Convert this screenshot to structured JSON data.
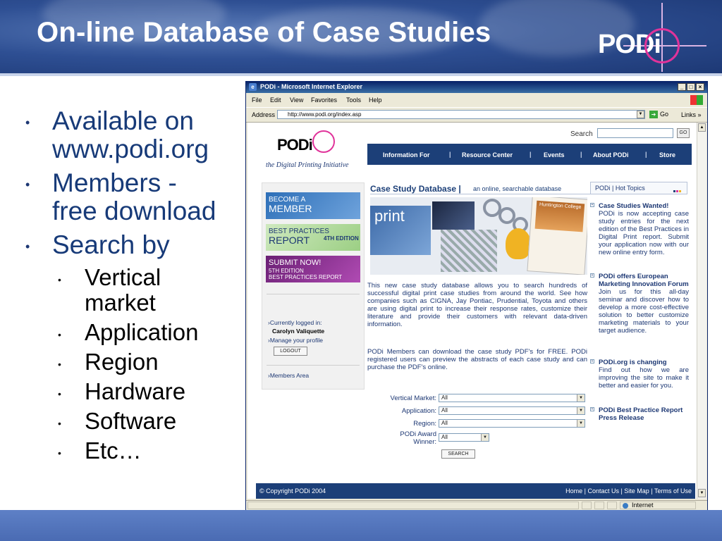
{
  "slide": {
    "title": "On-line Database of Case Studies",
    "logo_text": "PODi",
    "bullets": [
      {
        "level": 1,
        "text_lines": [
          "Available on",
          "www.podi.org"
        ]
      },
      {
        "level": 1,
        "text_lines": [
          "Members -",
          "free download"
        ]
      },
      {
        "level": 1,
        "text_lines": [
          "Search by"
        ]
      },
      {
        "level": 2,
        "text_lines": [
          "Vertical",
          "market"
        ]
      },
      {
        "level": 2,
        "text_lines": [
          "Application"
        ]
      },
      {
        "level": 2,
        "text_lines": [
          "Region"
        ]
      },
      {
        "level": 2,
        "text_lines": [
          "Hardware"
        ]
      },
      {
        "level": 2,
        "text_lines": [
          "Software"
        ]
      },
      {
        "level": 2,
        "text_lines": [
          "Etc…"
        ]
      }
    ],
    "bullet_glyph": "•"
  },
  "browser": {
    "window_title": "PODi - Microsoft Internet Explorer",
    "win_buttons": {
      "minimize": "_",
      "maximize": "□",
      "close": "×"
    },
    "menu": {
      "file": "File",
      "edit": "Edit",
      "view": "View",
      "favorites": "Favorites",
      "tools": "Tools",
      "help": "Help"
    },
    "address_label": "Address",
    "address_value": "http://www.podi.org/index.asp",
    "go_label": "Go",
    "links_label": "Links »",
    "status_zone": "Internet"
  },
  "site": {
    "logo_text": "PODi",
    "tagline": "the Digital Printing Initiative",
    "search_label": "Search",
    "search_button": "GO",
    "nav": [
      "Information For",
      "Resource Center",
      "Events",
      "About PODi",
      "Store"
    ],
    "nav_sep": "|",
    "promos": [
      {
        "l1": "BECOME A",
        "l2": "MEMBER",
        "l3": ""
      },
      {
        "l1": "BEST PRACTICES",
        "l2": "REPORT",
        "l3": "4TH EDITION"
      },
      {
        "l1": "SUBMIT NOW!",
        "l2": "5TH EDITION",
        "l3": "BEST PRACTICES REPORT"
      }
    ],
    "logged_in_label": "›Currently logged in:",
    "user_name": "Carolyn Valiquette",
    "manage_profile": "›Manage your profile",
    "logout_button": "LOGOUT",
    "members_area": "›Members Area",
    "case_study_title": "Case Study Database |",
    "case_study_sub": "an online, searchable database",
    "collage_text": {
      "print": "print",
      "college": "Huntington College"
    },
    "para1": "This new case study database allows you to search hundreds of successful digital print case studies from around the world. See how companies such as CIGNA, Jay Pontiac, Prudential, Toyota and others are using digital print to increase their response rates, customize their literature and provide their customers with relevant data-driven information.",
    "para2": "PODi Members can download the case study PDF's for FREE. PODi registered users can preview the abstracts of each case study and can purchase the PDF's online.",
    "form": {
      "vertical_label": "Vertical Market:",
      "application_label": "Application:",
      "region_label": "Region:",
      "award_label_1": "PODi Award",
      "award_label_2": "Winner:",
      "option_all": "All",
      "search_button": "SEARCH"
    },
    "hot_topics_title": "PODi | Hot Topics",
    "hot_topics": [
      {
        "heading": "Case Studies Wanted!",
        "desc": "PODi is now accepting case study entries for the next edition of the Best Practices in Digital Print report. Submit your application now with our new online entry form."
      },
      {
        "heading": "PODi offers European Marketing Innovation Forum",
        "desc": "Join us for this all-day seminar and discover how to develop a more cost-effective solution to better customize marketing materials to your target audience."
      },
      {
        "heading": "PODi.org is changing",
        "desc": "Find out how we are improving the site to make it better and easier for you."
      },
      {
        "heading": "PODi Best Practice Report Press Release",
        "desc": ""
      }
    ],
    "footer_copyright": "© Copyright PODi 2004",
    "footer_links": "Home | Contact Us | Site Map | Terms of Use"
  },
  "colors": {
    "slide_blue": "#1c3773",
    "nav_blue": "#1c3f78",
    "magenta": "#e0339a",
    "promo_member": "#2d6fb8",
    "promo_practices": "#9ccf84",
    "promo_submit": "#8a2d8e"
  }
}
